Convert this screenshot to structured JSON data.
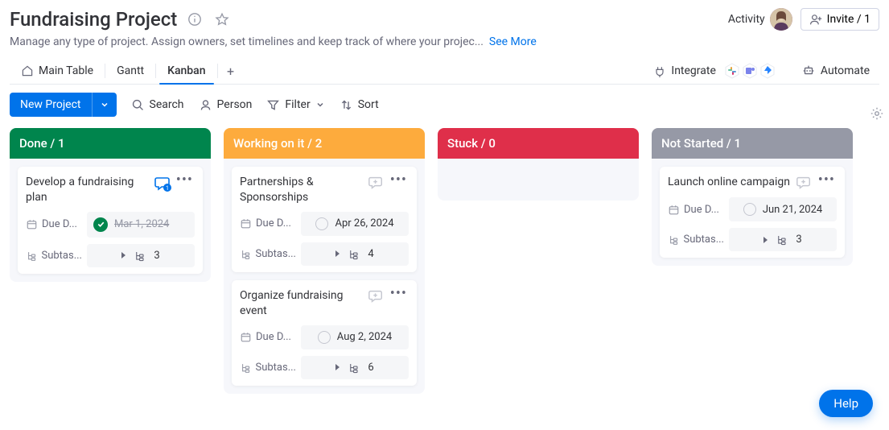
{
  "header": {
    "title": "Fundraising Project",
    "description": "Manage any type of project. Assign owners, set timelines and keep track of where your projec...",
    "see_more": "See More",
    "activity_label": "Activity",
    "invite_label": "Invite / 1"
  },
  "tabs": {
    "main": "Main Table",
    "gantt": "Gantt",
    "kanban": "Kanban"
  },
  "right": {
    "integrate": "Integrate",
    "automate": "Automate"
  },
  "toolbar": {
    "new_project": "New Project",
    "search": "Search",
    "person": "Person",
    "filter": "Filter",
    "sort": "Sort"
  },
  "columns": [
    {
      "name": "Done",
      "count": 1,
      "color": "#00854d"
    },
    {
      "name": "Working on it",
      "count": 2,
      "color": "#fdab3d"
    },
    {
      "name": "Stuck",
      "count": 0,
      "color": "#df2f4a"
    },
    {
      "name": "Not Started",
      "count": 1,
      "color": "#9699a6"
    }
  ],
  "labels": {
    "due": "Due D...",
    "subtasks": "Subtas..."
  },
  "cards": {
    "done": [
      {
        "title": "Develop a fundraising plan",
        "date": "Mar 1, 2024",
        "done": true,
        "subtasks": 3,
        "has_chat": true
      }
    ],
    "working": [
      {
        "title": "Partnerships & Sponsorships",
        "date": "Apr 26, 2024",
        "done": false,
        "subtasks": 4,
        "has_chat": false
      },
      {
        "title": "Organize fundraising event",
        "date": "Aug 2, 2024",
        "done": false,
        "subtasks": 6,
        "has_chat": false
      }
    ],
    "stuck": [],
    "notstarted": [
      {
        "title": "Launch online campaign",
        "date": "Jun 21, 2024",
        "done": false,
        "subtasks": 3,
        "has_chat": false
      }
    ]
  },
  "help": "Help"
}
